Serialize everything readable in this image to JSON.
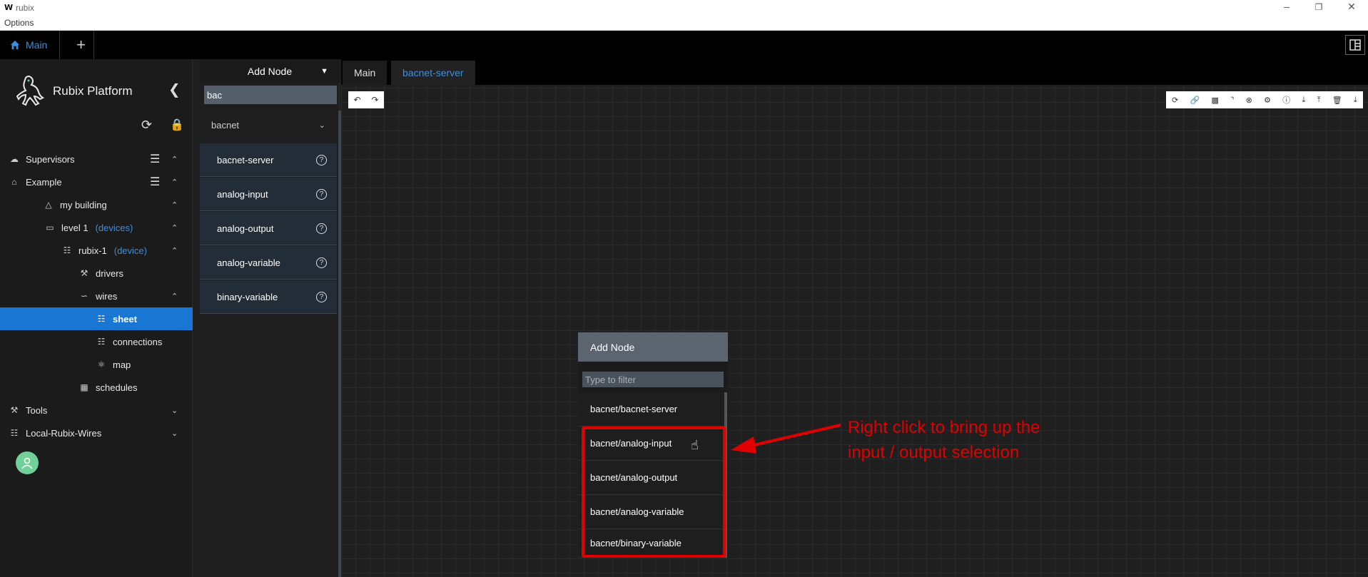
{
  "window": {
    "logo": "W",
    "title": "rubix",
    "menu_options": "Options"
  },
  "appbar": {
    "main_tab": "Main",
    "add_tab": "+"
  },
  "sidebar": {
    "brand": "Rubix Platform",
    "items": [
      {
        "label": "Supervisors",
        "icon": "cloud-icon"
      },
      {
        "label": "Example",
        "icon": "home-icon"
      },
      {
        "label": "my building",
        "icon": "building-icon"
      },
      {
        "label": "level 1",
        "tag": "(devices)",
        "icon": "laptop-icon"
      },
      {
        "label": "rubix-1",
        "tag": "(device)",
        "icon": "device-icon"
      },
      {
        "label": "drivers",
        "icon": "wrench-icon"
      },
      {
        "label": "wires",
        "icon": "wires-icon"
      },
      {
        "label": "sheet",
        "icon": "sheet-icon"
      },
      {
        "label": "connections",
        "icon": "connections-icon"
      },
      {
        "label": "map",
        "icon": "map-icon"
      },
      {
        "label": "schedules",
        "icon": "calendar-icon"
      },
      {
        "label": "Tools",
        "icon": "tools-icon"
      },
      {
        "label": "Local-Rubix-Wires",
        "icon": "network-icon"
      }
    ]
  },
  "palette": {
    "header": "Add Node",
    "search_value": "bac",
    "group": "bacnet",
    "items": [
      "bacnet-server",
      "analog-input",
      "analog-output",
      "analog-variable",
      "binary-variable"
    ]
  },
  "editor": {
    "tabs": [
      "Main",
      "bacnet-server"
    ]
  },
  "popup": {
    "title": "Add Node",
    "filter_placeholder": "Type to filter",
    "items": [
      "bacnet/bacnet-server",
      "bacnet/analog-input",
      "bacnet/analog-output",
      "bacnet/analog-variable",
      "bacnet/binary-variable"
    ]
  },
  "annotation": {
    "line1": "Right click to bring up the",
    "line2": "input / output selection",
    "color": "#e00000"
  },
  "colors": {
    "accent": "#3d8fe0",
    "active": "#1976d2"
  }
}
